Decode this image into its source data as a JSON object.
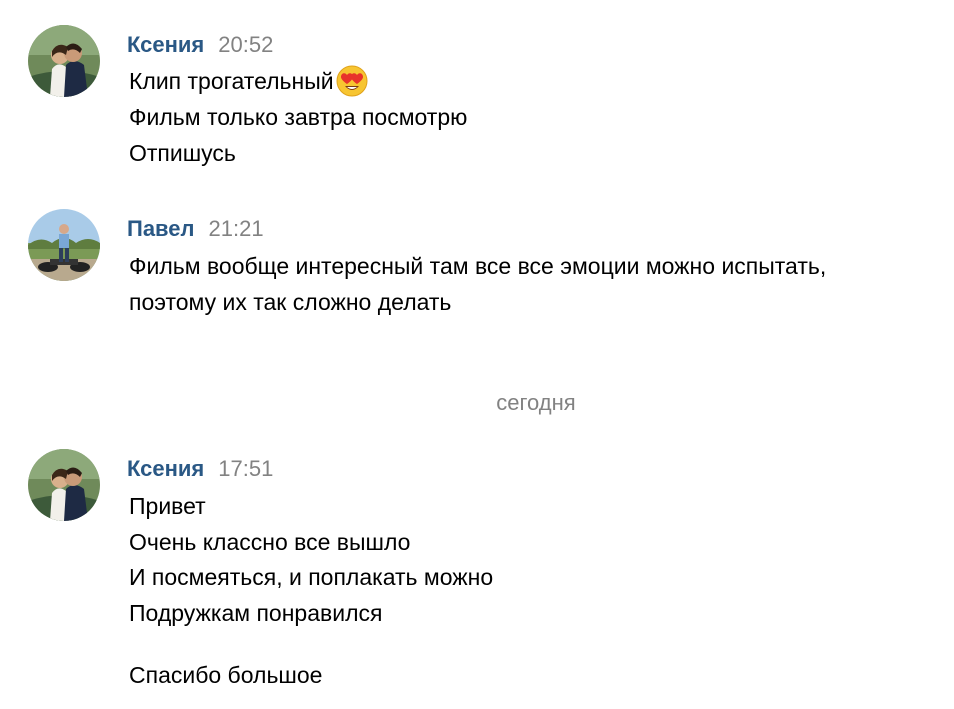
{
  "messages": [
    {
      "author": "Ксения",
      "time": "20:52",
      "lines": [
        "Клип трогательный",
        "Фильм только завтра посмотрю",
        "Отпишусь"
      ],
      "emoji": "heart-eyes-emoji"
    },
    {
      "author": "Павел",
      "time": "21:21",
      "lines": [
        "Фильм вообще интересный там все все эмоции можно испытать,",
        "поэтому их так сложно делать"
      ]
    },
    {
      "author": "Ксения",
      "time": "17:51",
      "lines": [
        "Привет",
        "Очень классно все вышло",
        "И посмеяться, и поплакать можно",
        "Подружкам понравился",
        "Спасибо большое"
      ]
    }
  ],
  "date_separator": "сегодня",
  "colors": {
    "author": "#2a5885",
    "time": "#828282",
    "text": "#000000"
  }
}
